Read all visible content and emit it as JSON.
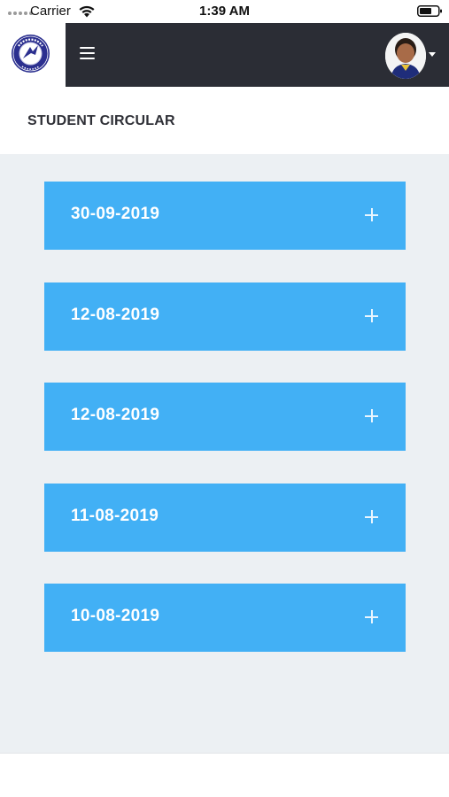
{
  "status_bar": {
    "carrier": "Carrier",
    "time": "1:39 AM",
    "icons": [
      "signal-dots-icon",
      "wifi-icon",
      "battery-icon"
    ]
  },
  "header": {
    "logo": {
      "icon": "school-logo-icon",
      "brand_color": "#2b2f8f"
    },
    "menu_icon": "hamburger-menu-icon",
    "avatar": "student-avatar",
    "caret_icon": "caret-down-icon",
    "background": "#2b2d35"
  },
  "page": {
    "title": "STUDENT CIRCULAR"
  },
  "circulars": [
    {
      "date": "30-09-2019"
    },
    {
      "date": "12-08-2019"
    },
    {
      "date": "12-08-2019"
    },
    {
      "date": "11-08-2019"
    },
    {
      "date": "10-08-2019"
    }
  ],
  "colors": {
    "accent": "#42b0f5",
    "list_background": "#ecf0f3"
  }
}
